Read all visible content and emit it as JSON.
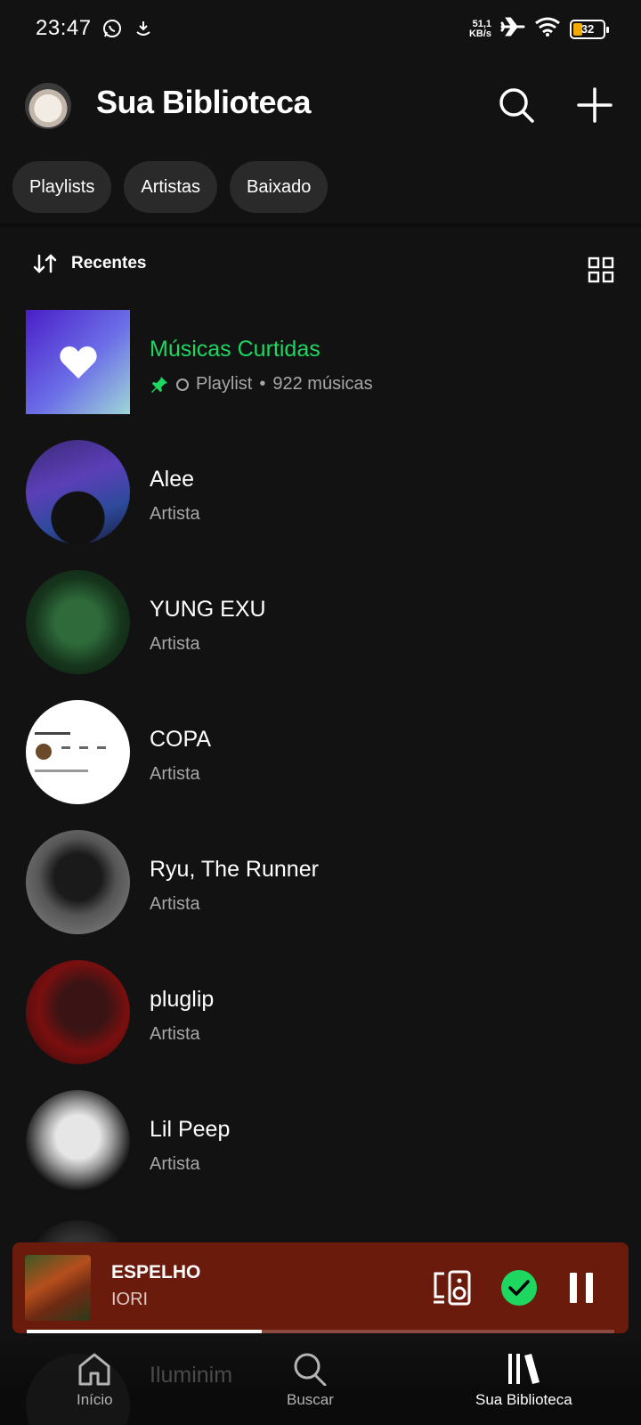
{
  "status": {
    "time": "23:47",
    "speed_value": "51,1",
    "speed_unit": "KB/s",
    "battery": "32"
  },
  "header": {
    "title": "Sua Biblioteca"
  },
  "filters": [
    "Playlists",
    "Artistas",
    "Baixado"
  ],
  "sort": {
    "label": "Recentes"
  },
  "items": [
    {
      "title": "Músicas Curtidas",
      "type": "Playlist",
      "count": "922 músicas",
      "pinned": true
    },
    {
      "title": "Alee",
      "subtitle": "Artista"
    },
    {
      "title": "YUNG EXU",
      "subtitle": "Artista"
    },
    {
      "title": "COPA",
      "subtitle": "Artista"
    },
    {
      "title": "Ryu, The Runner",
      "subtitle": "Artista"
    },
    {
      "title": "pluglip",
      "subtitle": "Artista"
    },
    {
      "title": "Lil Peep",
      "subtitle": "Artista"
    }
  ],
  "peek_item": {
    "title": "Iluminim"
  },
  "player": {
    "title": "ESPELHO",
    "artist": "IORI",
    "progress": 0.4
  },
  "nav": {
    "home": "Início",
    "search": "Buscar",
    "library": "Sua Biblioteca"
  },
  "colors": {
    "accent": "#1ed760",
    "player_bg": "#6a1b0c",
    "background": "#121212"
  }
}
